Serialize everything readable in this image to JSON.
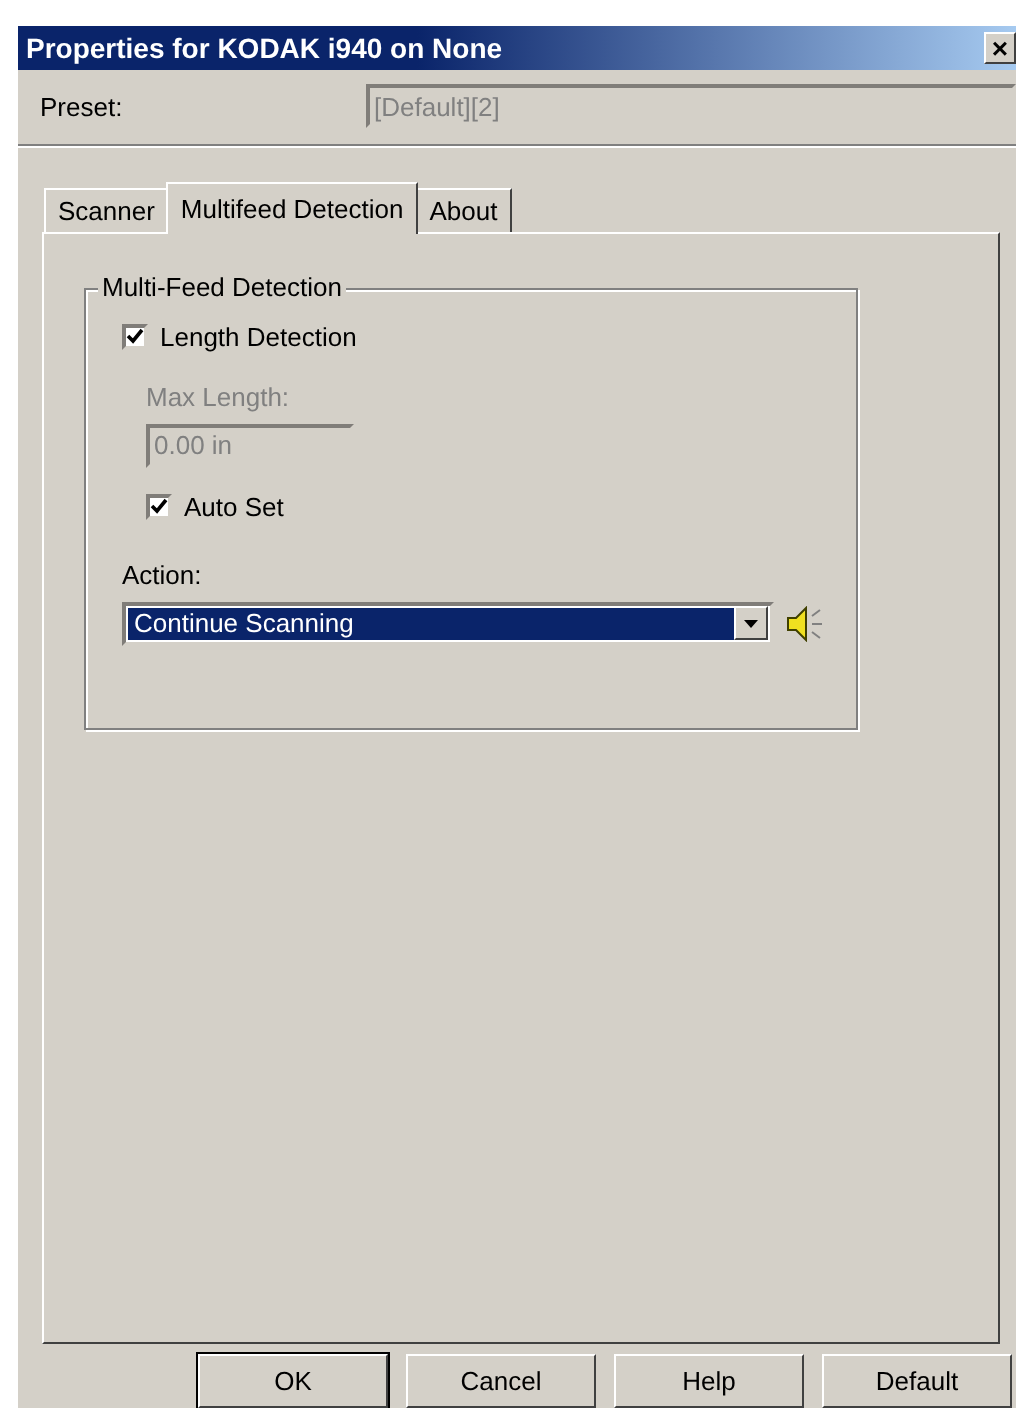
{
  "window": {
    "title": "Properties for KODAK i940 on None",
    "close": "×"
  },
  "preset": {
    "label": "Preset:",
    "value": "[Default][2]",
    "disabled": true
  },
  "tabs": [
    {
      "label": "Scanner",
      "selected": false
    },
    {
      "label": "Multifeed Detection",
      "selected": true
    },
    {
      "label": "About",
      "selected": false
    }
  ],
  "group": {
    "title": "Multi-Feed Detection",
    "length_detection": {
      "label": "Length Detection",
      "checked": true
    },
    "max_length": {
      "label": "Max Length:",
      "value": "0.00 in",
      "disabled": true
    },
    "auto_set": {
      "label": "Auto Set",
      "checked": true
    },
    "action": {
      "label": "Action:",
      "value": "Continue Scanning"
    }
  },
  "buttons": [
    {
      "label": "OK",
      "default": true
    },
    {
      "label": "Cancel",
      "default": false
    },
    {
      "label": "Help",
      "default": false
    },
    {
      "label": "Default",
      "default": false
    }
  ]
}
